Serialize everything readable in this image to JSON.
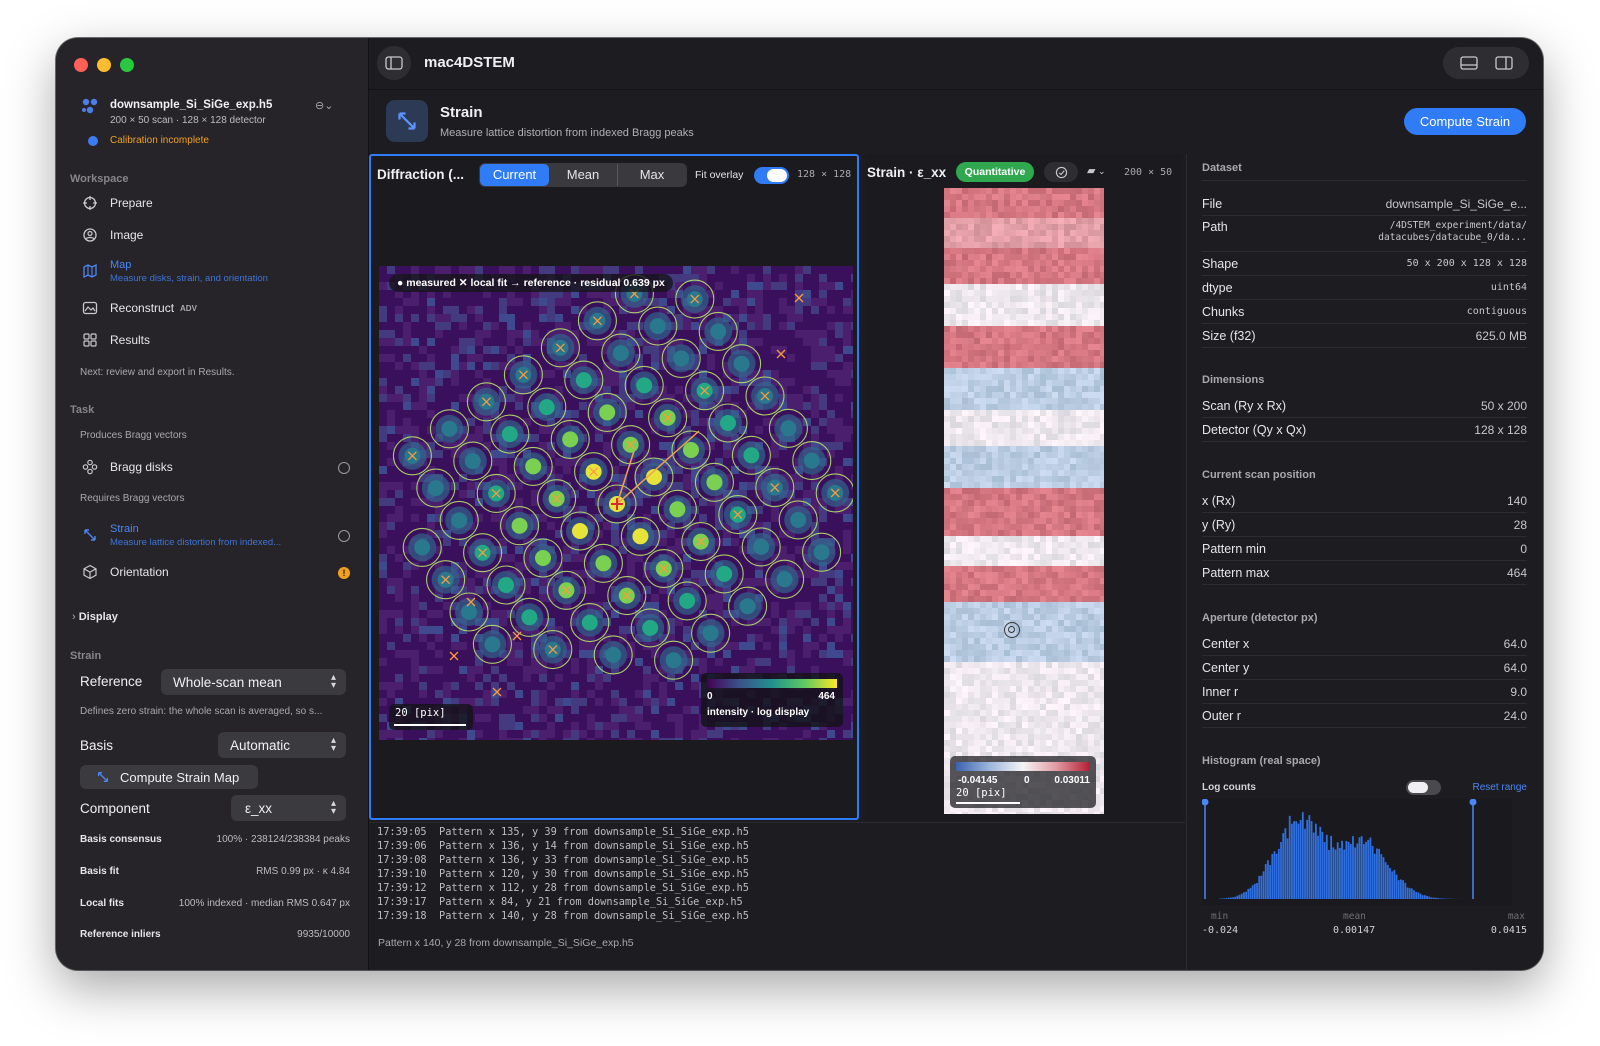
{
  "app": {
    "title": "mac4DSTEM"
  },
  "file": {
    "name": "downsample_Si_SiGe_exp.h5",
    "info": "200 × 50 scan  ·  128 × 128 detector",
    "warning": "Calibration incomplete"
  },
  "sidebar": {
    "workspace_header": "Workspace",
    "items": [
      {
        "label": "Prepare"
      },
      {
        "label": "Image"
      },
      {
        "label": "Map",
        "sub": "Measure disks, strain, and orientation"
      },
      {
        "label": "Reconstruct",
        "badge": "ADV"
      },
      {
        "label": "Results"
      }
    ],
    "next_hint": "Next: review and export in Results.",
    "task_header": "Task",
    "produces_label": "Produces Bragg vectors",
    "bragg_label": "Bragg disks",
    "requires_label": "Requires Bragg vectors",
    "strain_label": "Strain",
    "strain_sub": "Measure lattice distortion from indexed...",
    "orientation_label": "Orientation",
    "display_label": "Display",
    "strain_header": "Strain",
    "reference_label": "Reference",
    "reference_value": "Whole-scan mean",
    "reference_desc": "Defines zero strain: the whole scan is averaged, so s...",
    "basis_label": "Basis",
    "basis_value": "Automatic",
    "compute_map_button": "Compute Strain Map",
    "component_label": "Component",
    "component_value": "ε_xx",
    "stats": [
      {
        "k": "Basis consensus",
        "v": "100% · 238124/238384 peaks"
      },
      {
        "k": "Basis fit",
        "v": "RMS 0.99 px · κ 4.84"
      },
      {
        "k": "Local fits",
        "v": "100% indexed · median RMS 0.647 px"
      },
      {
        "k": "Reference inliers",
        "v": "9935/10000"
      }
    ]
  },
  "header": {
    "title": "Strain",
    "subtitle": "Measure lattice distortion from indexed Bragg peaks",
    "compute_button": "Compute Strain"
  },
  "diffraction": {
    "title": "Diffraction (...",
    "tabs": [
      "Current",
      "Mean",
      "Max"
    ],
    "active_tab": "Current",
    "fit_overlay_label": "Fit overlay",
    "fit_overlay_on": true,
    "size": "128 × 128",
    "legend": "● measured  ✕ local fit  → reference · residual 0.639 px",
    "scalebar": "20 [pix]",
    "cbar_min": "0",
    "cbar_max": "464",
    "cbar_label": "intensity · log display"
  },
  "strain_panel": {
    "title": "Strain · ε_xx",
    "badge": "Quantitative",
    "size": "200 × 50",
    "cbar_min": "-0.04145",
    "cbar_mid": "0",
    "cbar_max": "0.03011",
    "scalebar": "20 [pix]"
  },
  "log": {
    "lines": [
      "17:39:05  Pattern x 135, y 39 from downsample_Si_SiGe_exp.h5",
      "17:39:06  Pattern x 136, y 14 from downsample_Si_SiGe_exp.h5",
      "17:39:08  Pattern x 136, y 33 from downsample_Si_SiGe_exp.h5",
      "17:39:10  Pattern x 120, y 30 from downsample_Si_SiGe_exp.h5",
      "17:39:12  Pattern x 112, y 28 from downsample_Si_SiGe_exp.h5",
      "17:39:17  Pattern x 84, y 21 from downsample_Si_SiGe_exp.h5",
      "17:39:18  Pattern x 140, y 28 from downsample_Si_SiGe_exp.h5"
    ],
    "status": "Pattern x 140, y 28 from downsample_Si_SiGe_exp.h5"
  },
  "dataset": {
    "header": "Dataset",
    "rows": [
      {
        "k": "File",
        "v": "downsample_Si_SiGe_e..."
      },
      {
        "k": "Path",
        "v": "/4DSTEM_experiment/data/",
        "v2": "datacubes/datacube_0/da..."
      },
      {
        "k": "Shape",
        "v": "50 x 200 x 128 x 128"
      },
      {
        "k": "dtype",
        "v": "uint64"
      },
      {
        "k": "Chunks",
        "v": "contiguous"
      },
      {
        "k": "Size (f32)",
        "v": "625.0 MB"
      }
    ],
    "dims_header": "Dimensions",
    "dims": [
      {
        "k": "Scan (Ry x Rx)",
        "v": "50 x 200"
      },
      {
        "k": "Detector (Qy x Qx)",
        "v": "128 x 128"
      }
    ],
    "pos_header": "Current scan position",
    "pos": [
      {
        "k": "x (Rx)",
        "v": "140"
      },
      {
        "k": "y (Ry)",
        "v": "28"
      },
      {
        "k": "Pattern min",
        "v": "0"
      },
      {
        "k": "Pattern max",
        "v": "464"
      }
    ],
    "ap_header": "Aperture (detector px)",
    "ap": [
      {
        "k": "Center x",
        "v": "64.0"
      },
      {
        "k": "Center y",
        "v": "64.0"
      },
      {
        "k": "Inner r",
        "v": "9.0"
      },
      {
        "k": "Outer r",
        "v": "24.0"
      }
    ],
    "hist_header": "Histogram (real space)",
    "log_counts": "Log counts",
    "log_counts_on": false,
    "reset_range": "Reset range",
    "hist_min_label": "min",
    "hist_mean_label": "mean",
    "hist_max_label": "max",
    "hist_min": "-0.024",
    "hist_mean": "0.00147",
    "hist_max": "0.0415"
  },
  "colors": {
    "accent": "#2f7cf6",
    "quant_green": "#2fa84f",
    "warning": "#f0a020",
    "background": "#1d1d21",
    "sidebar": "#262429"
  },
  "icons": [
    "sidebar-toggle-icon",
    "strain-arrows-icon",
    "target-icon",
    "print-icon",
    "layout-bottom-icon",
    "layout-right-icon",
    "ellipsis-icon"
  ]
}
